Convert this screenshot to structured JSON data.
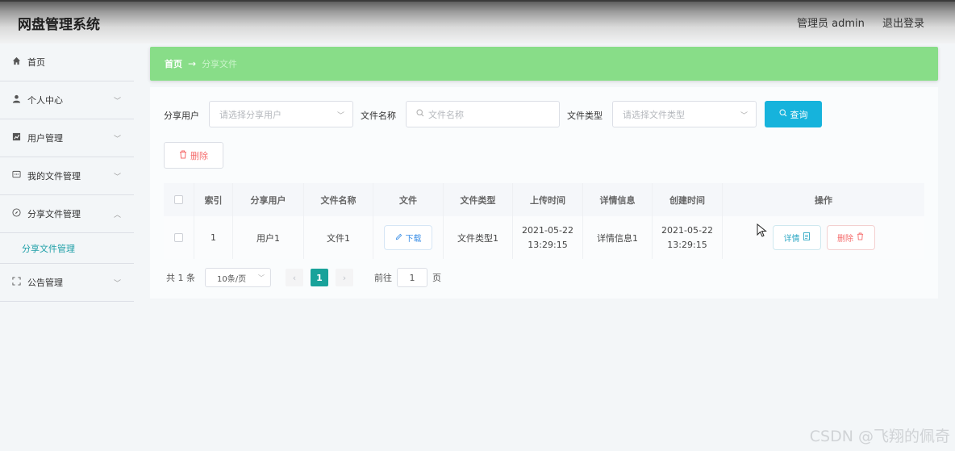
{
  "header": {
    "title": "网盘管理系统",
    "user_label": "管理员 admin",
    "logout_label": "退出登录"
  },
  "sidebar": {
    "items": [
      {
        "label": "首页",
        "icon": "home-icon"
      },
      {
        "label": "个人中心",
        "icon": "user-icon"
      },
      {
        "label": "用户管理",
        "icon": "chart-icon"
      },
      {
        "label": "我的文件管理",
        "icon": "message-icon"
      },
      {
        "label": "分享文件管理",
        "icon": "compass-icon",
        "expanded": true
      },
      {
        "label": "公告管理",
        "icon": "fullscreen-icon"
      }
    ],
    "sub_item": "分享文件管理"
  },
  "breadcrumb": {
    "home": "首页",
    "arrow": "→",
    "current": "分享文件"
  },
  "filters": {
    "share_user_label": "分享用户",
    "share_user_placeholder": "请选择分享用户",
    "file_name_label": "文件名称",
    "file_name_placeholder": "文件名称",
    "file_type_label": "文件类型",
    "file_type_placeholder": "请选择文件类型",
    "query_button": "查询",
    "delete_button": "删除"
  },
  "table": {
    "columns": [
      "",
      "索引",
      "分享用户",
      "文件名称",
      "文件",
      "文件类型",
      "上传时间",
      "详情信息",
      "创建时间",
      "操作"
    ],
    "rows": [
      {
        "index": "1",
        "share_user": "用户1",
        "file_name": "文件1",
        "file_button": "下载",
        "file_type": "文件类型1",
        "upload_date": "2021-05-22",
        "upload_time": "13:29:15",
        "detail_info": "详情信息1",
        "create_date": "2021-05-22",
        "create_time": "13:29:15",
        "detail_button": "详情",
        "delete_button": "删除"
      }
    ]
  },
  "pagination": {
    "total": "共 1 条",
    "page_size": "10条/页",
    "current_page": "1",
    "goto_label": "前往",
    "goto_value": "1",
    "page_unit": "页"
  },
  "watermark": "CSDN @飞翔的佩奇",
  "colors": {
    "breadcrumb_bg": "#88dd88",
    "query_button": "#16b3dc",
    "active_page": "#18a29a",
    "danger": "#f56c6c"
  }
}
